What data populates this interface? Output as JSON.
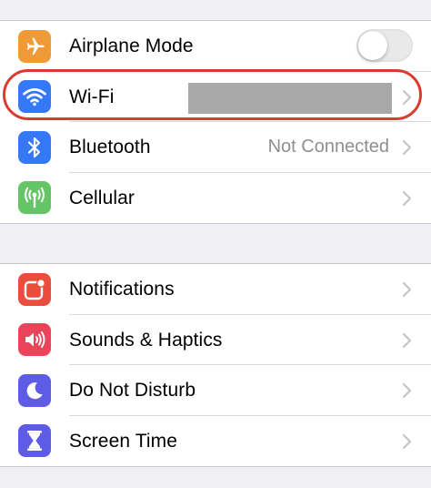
{
  "groups": [
    {
      "rows": [
        {
          "label": "Airplane Mode",
          "icon": "airplane-icon",
          "icon_color": "#f09a37",
          "accessory": "toggle",
          "toggle_on": false
        },
        {
          "label": "Wi-Fi",
          "icon": "wifi-icon",
          "icon_color": "#3478f6",
          "accessory": "chevron",
          "value_redacted": true
        },
        {
          "label": "Bluetooth",
          "icon": "bluetooth-icon",
          "icon_color": "#3478f6",
          "accessory": "chevron",
          "value": "Not Connected"
        },
        {
          "label": "Cellular",
          "icon": "cellular-antenna-icon",
          "icon_color": "#65c466",
          "accessory": "chevron"
        }
      ]
    },
    {
      "rows": [
        {
          "label": "Notifications",
          "icon": "notifications-icon",
          "icon_color": "#eb4d3d",
          "accessory": "chevron"
        },
        {
          "label": "Sounds & Haptics",
          "icon": "speaker-icon",
          "icon_color": "#eb445a",
          "accessory": "chevron"
        },
        {
          "label": "Do Not Disturb",
          "icon": "moon-icon",
          "icon_color": "#5e5ce6",
          "accessory": "chevron"
        },
        {
          "label": "Screen Time",
          "icon": "hourglass-icon",
          "icon_color": "#5e5ce6",
          "accessory": "chevron"
        }
      ]
    }
  ],
  "colors": {
    "background": "#efeff4",
    "highlight_ring": "#d83c2f",
    "secondary_text": "#8e8e93",
    "chevron": "#c4c4c7"
  }
}
